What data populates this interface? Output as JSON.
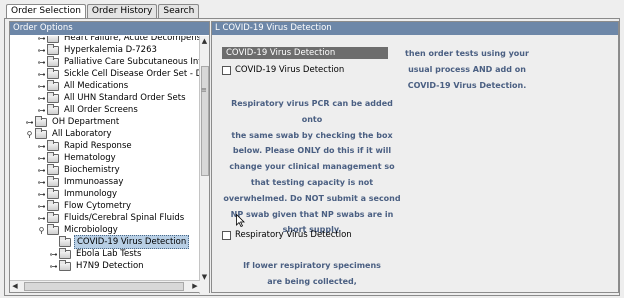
{
  "tabs": [
    {
      "label": "Order Selection",
      "active": true
    },
    {
      "label": "Order History",
      "active": false
    },
    {
      "label": "Search",
      "active": false
    }
  ],
  "left_panel": {
    "title": "Order Options",
    "tree": [
      {
        "label": "Heart Failure, Acute Decompensated -",
        "indent": 1,
        "expanded": false
      },
      {
        "label": "Hyperkalemia D-7263",
        "indent": 1,
        "expanded": false
      },
      {
        "label": "Palliative Care Subcutaneous Intermitt",
        "indent": 1,
        "expanded": false
      },
      {
        "label": "Sickle Cell Disease Order Set - D-700",
        "indent": 1,
        "expanded": false
      },
      {
        "label": "All Medications",
        "indent": 1,
        "expanded": false
      },
      {
        "label": "All UHN Standard Order Sets",
        "indent": 1,
        "expanded": false
      },
      {
        "label": "All Order Screens",
        "indent": 1,
        "expanded": false
      },
      {
        "label": "OH Department",
        "indent": 0,
        "expanded": false
      },
      {
        "label": "All Laboratory",
        "indent": 0,
        "expanded": true
      },
      {
        "label": "Rapid Response",
        "indent": 1,
        "expanded": false
      },
      {
        "label": "Hematology",
        "indent": 1,
        "expanded": false
      },
      {
        "label": "Biochemistry",
        "indent": 1,
        "expanded": false
      },
      {
        "label": "Immunoassay",
        "indent": 1,
        "expanded": false
      },
      {
        "label": "Immunology",
        "indent": 1,
        "expanded": false
      },
      {
        "label": "Flow Cytometry",
        "indent": 1,
        "expanded": false
      },
      {
        "label": "Fluids/Cerebral Spinal Fluids",
        "indent": 1,
        "expanded": false
      },
      {
        "label": "Microbiology",
        "indent": 1,
        "expanded": true
      },
      {
        "label": "COVID-19 Virus Detection",
        "indent": 2,
        "expanded": false,
        "selected": true,
        "leaf": true
      },
      {
        "label": "Ebola Lab Tests",
        "indent": 2,
        "expanded": false
      },
      {
        "label": "H7N9 Detection",
        "indent": 2,
        "expanded": false
      }
    ]
  },
  "right_panel": {
    "title": "L COVID-19 Virus Detection",
    "selected_option": "COVID-19 Virus Detection",
    "checkbox_1": {
      "label": "COVID-19 Virus Detection",
      "checked": false
    },
    "message_1": [
      "Respiratory virus PCR can be added onto",
      "the same swab by checking the box",
      "below. Please ONLY do this if it will",
      "change your clinical management so",
      "that testing capacity is not",
      "overwhelmed. Do NOT submit a second",
      "NP swab given that NP swabs are in",
      "short supply."
    ],
    "checkbox_2": {
      "label": "Respiratory Virus Detection",
      "checked": false
    },
    "message_2": [
      "If lower respiratory specimens",
      "are being collected,"
    ],
    "message_right": [
      "then order tests using your",
      "usual process AND add on",
      "COVID-19 Virus Detection."
    ]
  },
  "colors": {
    "title_bar": "#6d87a8",
    "selection": "#b8cfe5",
    "message_text": "#4a5f82",
    "selected_option_bg": "#6d6d6d"
  }
}
